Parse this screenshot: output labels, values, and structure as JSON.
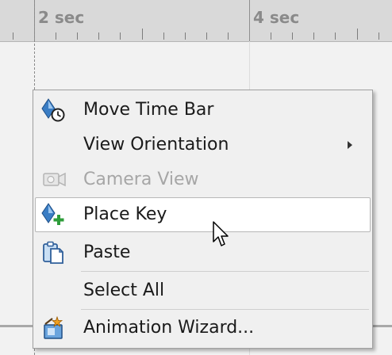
{
  "timeline": {
    "labels": [
      "2 sec",
      "4 sec"
    ]
  },
  "context_menu": {
    "items": [
      {
        "label": "Move Time Bar",
        "icon": "move-time-bar-icon",
        "enabled": true,
        "submenu": false
      },
      {
        "label": "View Orientation",
        "icon": "",
        "enabled": true,
        "submenu": true
      },
      {
        "label": "Camera View",
        "icon": "camera-icon",
        "enabled": false,
        "submenu": false
      },
      {
        "label": "Place Key",
        "icon": "place-key-icon",
        "enabled": true,
        "submenu": false,
        "highlighted": true
      },
      {
        "label": "Paste",
        "icon": "paste-icon",
        "enabled": true,
        "submenu": false
      },
      {
        "label": "Select All",
        "icon": "",
        "enabled": true,
        "submenu": false
      },
      {
        "label": "Animation Wizard...",
        "icon": "animation-wizard-icon",
        "enabled": true,
        "submenu": false
      }
    ]
  },
  "colors": {
    "ruler": "#d9d9d9",
    "menu_background": "#f0f0f0",
    "highlight": "#ffffff",
    "key_blue": "#3a7dc4",
    "plus_green": "#2e9d3a",
    "disabled_text": "#a6a6a6"
  }
}
